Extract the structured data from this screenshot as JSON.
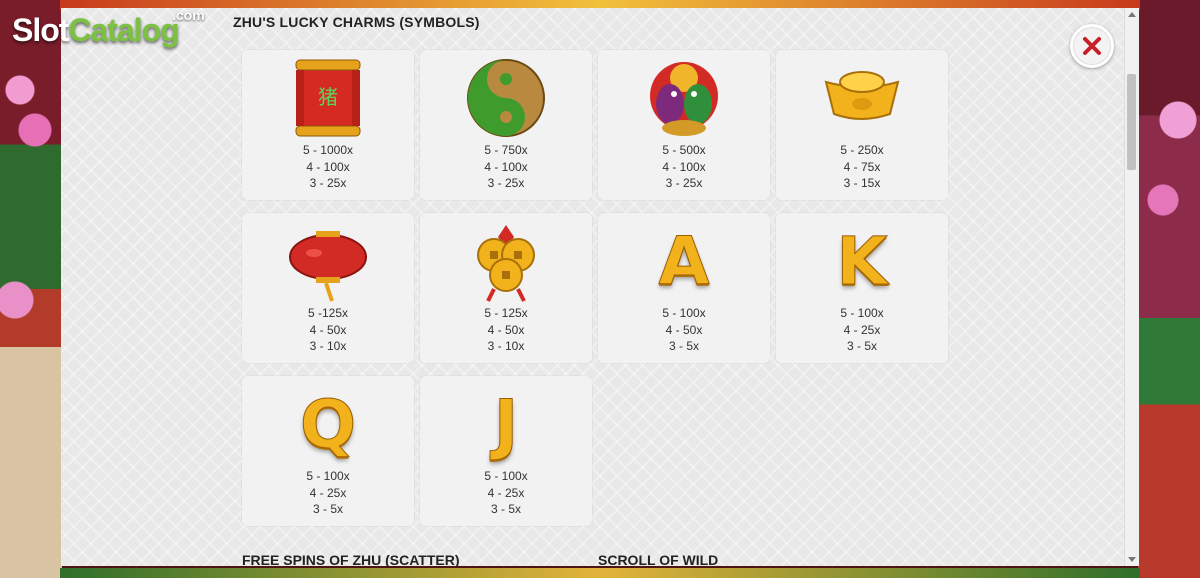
{
  "watermark": {
    "part1": "Slot",
    "part2": "Catalog",
    "suffix": ".com"
  },
  "modal": {
    "title": "ZHU'S LUCKY CHARMS (SYMBOLS)",
    "close_icon": "close-icon",
    "colors": {
      "close": "#c8202a",
      "gold": "#f2b21b",
      "red": "#c8202a"
    }
  },
  "symbols": [
    {
      "name": "scroll",
      "icon": "scroll-icon",
      "pays": [
        "5 - 1000x",
        "4 - 100x",
        "3 - 25x"
      ]
    },
    {
      "name": "yin-yang",
      "icon": "yin-yang-icon",
      "pays": [
        "5 - 750x",
        "4 - 100x",
        "3 - 25x"
      ]
    },
    {
      "name": "birds",
      "icon": "love-birds-icon",
      "pays": [
        "5 - 500x",
        "4 - 100x",
        "3 - 25x"
      ]
    },
    {
      "name": "gold-ingot",
      "icon": "gold-ingot-icon",
      "pays": [
        "5 - 250x",
        "4 - 75x",
        "3 - 15x"
      ]
    },
    {
      "name": "lantern",
      "icon": "lantern-icon",
      "pays": [
        "5 -125x",
        "4 - 50x",
        "3 - 10x"
      ]
    },
    {
      "name": "coins",
      "icon": "coins-icon",
      "pays": [
        "5 - 125x",
        "4 - 50x",
        "3 - 10x"
      ]
    },
    {
      "name": "A",
      "icon": "letter-a-icon",
      "glyph": "A",
      "pays": [
        "5 - 100x",
        "4 - 50x",
        "3 - 5x"
      ]
    },
    {
      "name": "K",
      "icon": "letter-k-icon",
      "glyph": "K",
      "pays": [
        "5 - 100x",
        "4 - 25x",
        "3 - 5x"
      ]
    },
    {
      "name": "Q",
      "icon": "letter-q-icon",
      "glyph": "Q",
      "pays": [
        "5 - 100x",
        "4 - 25x",
        "3 - 5x"
      ]
    },
    {
      "name": "J",
      "icon": "letter-j-icon",
      "glyph": "J",
      "pays": [
        "5 - 100x",
        "4 - 25x",
        "3 - 5x"
      ]
    }
  ],
  "sections": {
    "free_spins": "FREE SPINS OF ZHU (SCATTER)",
    "scroll_wild": "SCROLL OF WILD"
  }
}
